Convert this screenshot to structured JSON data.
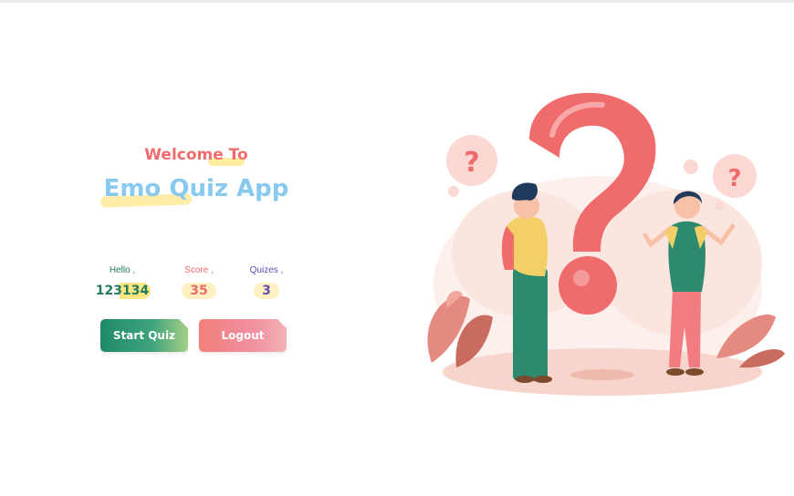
{
  "welcome": {
    "pre_title": "Welcome To",
    "title": "Emo Quiz App"
  },
  "stats": {
    "hello": {
      "label": "Hello ,",
      "value": "123134"
    },
    "score": {
      "label": "Score ,",
      "value": "35"
    },
    "quizzes": {
      "label": "Quizes ,",
      "value": "3"
    }
  },
  "buttons": {
    "start": "Start Quiz",
    "logout": "Logout"
  },
  "colors": {
    "coral": "#f06b6b",
    "sky": "#88c9f0",
    "green": "#1f7a5e",
    "purple": "#5f4fb3",
    "highlight": "#ffe680"
  },
  "illustration": {
    "icons": [
      "question-mark-icon",
      "person-male-icon",
      "person-female-icon",
      "leaf-icon"
    ]
  }
}
